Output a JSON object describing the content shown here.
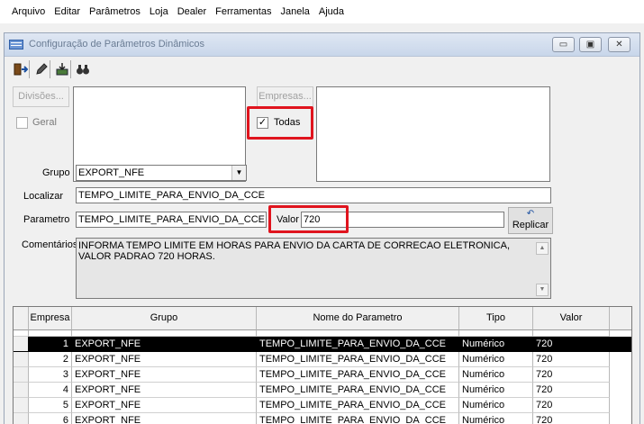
{
  "menu": [
    "Arquivo",
    "Editar",
    "Parâmetros",
    "Loja",
    "Dealer",
    "Ferramentas",
    "Janela",
    "Ajuda"
  ],
  "window": {
    "title": "Configuração de Parâmetros Dinâmicos",
    "min_label": "▭",
    "restore_label": "▣",
    "close_label": "✕"
  },
  "toolbar": {
    "exit_icon": "exit-icon",
    "edit_icon": "pencil-icon",
    "save_icon": "save-icon",
    "search_icon": "binoculars-icon"
  },
  "form": {
    "divisoes_label": "Divisões...",
    "geral_label": "Geral",
    "empresas_label": "Empresas...",
    "todas_label": "Todas",
    "todas_checked": "✓",
    "grupo_label": "Grupo",
    "grupo_value": "EXPORT_NFE",
    "localizar_label": "Localizar",
    "localizar_value": "TEMPO_LIMITE_PARA_ENVIO_DA_CCE",
    "parametro_label": "Parametro",
    "parametro_value": "TEMPO_LIMITE_PARA_ENVIO_DA_CCE",
    "valor_label": "Valor",
    "valor_value": "720",
    "replicar_label": "Replicar",
    "comentarios_label": "Comentários",
    "comentarios_line1": "INFORMA TEMPO LIMITE EM HORAS PARA ENVIO DA CARTA DE CORRECAO ELETRONICA,",
    "comentarios_line2": "VALOR PADRAO 720 HORAS."
  },
  "grid": {
    "columns": [
      "Empresa",
      "Grupo",
      "Nome do Parametro",
      "Tipo",
      "Valor"
    ],
    "rows": [
      [
        "1",
        "EXPORT_NFE",
        "TEMPO_LIMITE_PARA_ENVIO_DA_CCE",
        "Numérico",
        "720"
      ],
      [
        "2",
        "EXPORT_NFE",
        "TEMPO_LIMITE_PARA_ENVIO_DA_CCE",
        "Numérico",
        "720"
      ],
      [
        "3",
        "EXPORT_NFE",
        "TEMPO_LIMITE_PARA_ENVIO_DA_CCE",
        "Numérico",
        "720"
      ],
      [
        "4",
        "EXPORT_NFE",
        "TEMPO_LIMITE_PARA_ENVIO_DA_CCE",
        "Numérico",
        "720"
      ],
      [
        "5",
        "EXPORT_NFE",
        "TEMPO_LIMITE_PARA_ENVIO_DA_CCE",
        "Numérico",
        "720"
      ],
      [
        "6",
        "EXPORT_NFE",
        "TEMPO_LIMITE_PARA_ENVIO_DA_CCE",
        "Numérico",
        "720"
      ]
    ]
  },
  "colors": {
    "highlight": "#e0141e",
    "selected_row": "#000000"
  }
}
